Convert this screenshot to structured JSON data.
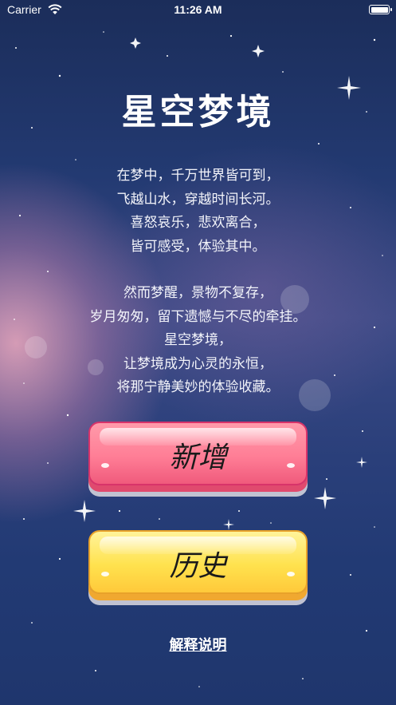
{
  "status_bar": {
    "carrier": "Carrier",
    "time": "11:26 AM"
  },
  "title": "星空梦境",
  "poem": {
    "stanza1": [
      "在梦中，千万世界皆可到，",
      "飞越山水，穿越时间长河。",
      "喜怒哀乐，悲欢离合，",
      "皆可感受，体验其中。"
    ],
    "stanza2": [
      "然而梦醒，景物不复存，",
      "岁月匆匆，留下遗憾与不尽的牵挂。",
      "星空梦境，",
      "让梦境成为心灵的永恒，",
      "将那宁静美妙的体验收藏。"
    ]
  },
  "buttons": {
    "add_label": "新增",
    "history_label": "历史",
    "explain_label": "解释说明"
  },
  "colors": {
    "add_button": "#ff7e96",
    "history_button": "#ffe24e",
    "background": "#233a72"
  },
  "icons": {
    "wifi": "wifi-icon",
    "battery": "battery-icon"
  }
}
